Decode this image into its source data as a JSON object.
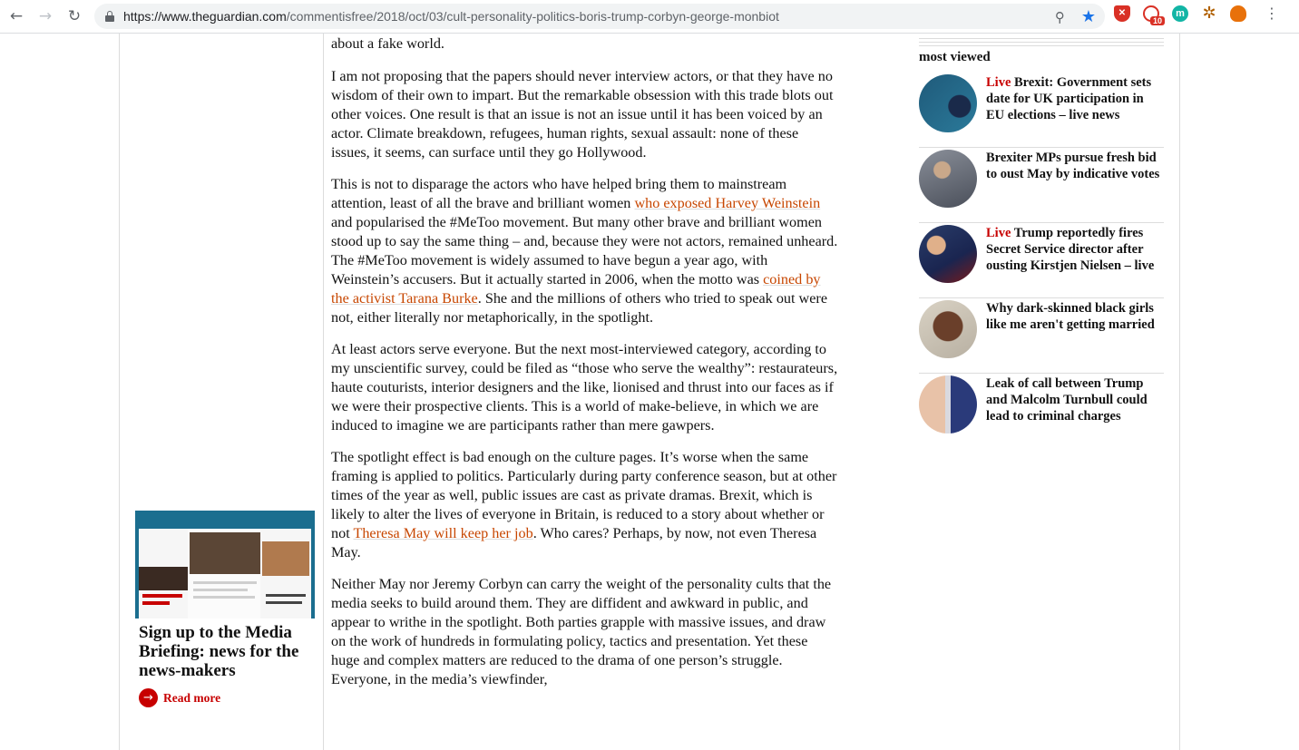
{
  "browser": {
    "url_host": "https://www.theguardian.com",
    "url_path": "/commentisfree/2018/oct/03/cult-personality-politics-boris-trump-corbyn-george-monbiot",
    "back_icon": "arrow-left-icon",
    "forward_icon": "arrow-right-icon",
    "reload_icon": "reload-icon",
    "extensions": [
      {
        "name": "shield-extension-icon"
      },
      {
        "name": "mail-extension-icon",
        "badge": "10"
      },
      {
        "name": "m-extension-icon",
        "letter": "m"
      },
      {
        "name": "gear-extension-icon"
      },
      {
        "name": "fox-extension-icon"
      }
    ],
    "accent_color": "#1a73e8"
  },
  "article": {
    "fragment": "about a fake world.",
    "paragraphs": [
      {
        "segments": [
          {
            "text": "I am not proposing that the papers should never interview actors, or that they have no wisdom of their own to impart. But the remarkable obsession with this trade blots out other voices. One result is that an issue is not an issue until it has been voiced by an actor. Climate breakdown, refugees, human rights, sexual assault: none of these issues, it seems, can surface until they go Hollywood."
          }
        ]
      },
      {
        "segments": [
          {
            "text": "This is not to disparage the actors who have helped bring them to mainstream attention, least of all the brave and brilliant women "
          },
          {
            "text": "who exposed Harvey Weinstein",
            "link": true
          },
          {
            "text": " and popularised the #MeToo movement. But many other brave and brilliant women stood up to say the same thing – and, because they were not actors, remained unheard. The #MeToo movement is widely assumed to have begun a year ago, with Weinstein’s accusers. But it actually started in 2006, when the motto was "
          },
          {
            "text": "coined by the activist Tarana Burke",
            "link": true
          },
          {
            "text": ". She and the millions of others who tried to speak out were not, either literally nor metaphorically, in the spotlight."
          }
        ]
      },
      {
        "segments": [
          {
            "text": "At least actors serve everyone. But the next most-interviewed category, according to my unscientific survey, could be filed as “those who serve the wealthy”: restaurateurs, haute couturists, interior designers and the like, lionised and thrust into our faces as if we were their prospective clients. This is a world of make-believe, in which we are induced to imagine we are participants rather than mere gawpers."
          }
        ]
      },
      {
        "segments": [
          {
            "text": "The spotlight effect is bad enough on the culture pages. It’s worse when the same framing is applied to politics. Particularly during party conference season, but at other times of the year as well, public issues are cast as private dramas. Brexit, which is likely to alter the lives of everyone in Britain, is reduced to a story about whether or not "
          },
          {
            "text": "Theresa May will keep her job",
            "link": true
          },
          {
            "text": ". Who cares? Perhaps, by now, not even Theresa May."
          }
        ]
      },
      {
        "segments": [
          {
            "text": "Neither May nor Jeremy Corbyn can carry the weight of the personality cults that the media seeks to build around them. They are diffident and awkward in public, and appear to writhe in the spotlight. Both parties grapple with massive issues, and draw on the work of hundreds in formulating policy, tactics and presentation. Yet these huge and complex matters are reduced to the drama of one person’s struggle. Everyone, in the media’s viewfinder,"
          }
        ]
      }
    ]
  },
  "promo": {
    "title": "Sign up to the Media Briefing: news for the news-makers",
    "cta_label": "Read more",
    "cta_icon": "arrow-right-circle-icon"
  },
  "most_viewed": {
    "heading": "most viewed",
    "items": [
      {
        "live": "Live",
        "headline": "Brexit: Government sets date for UK participation in EU elections – live news",
        "thumb": "brexit-press-conference-photo"
      },
      {
        "live": "",
        "headline": "Brexiter MPs pursue fresh bid to oust May by indicative votes",
        "thumb": "theresa-may-photo"
      },
      {
        "live": "Live",
        "headline": "Trump reportedly fires Secret Service director after ousting Kirstjen Nielsen – live",
        "thumb": "trump-flag-photo"
      },
      {
        "live": "",
        "headline": "Why dark-skinned black girls like me aren't getting married",
        "thumb": "woman-portrait-photo"
      },
      {
        "live": "",
        "headline": "Leak of call between Trump and Malcolm Turnbull could lead to criminal charges",
        "thumb": "trump-turnbull-photo"
      }
    ],
    "live_color": "#c70000"
  },
  "link_color": "#c74600"
}
